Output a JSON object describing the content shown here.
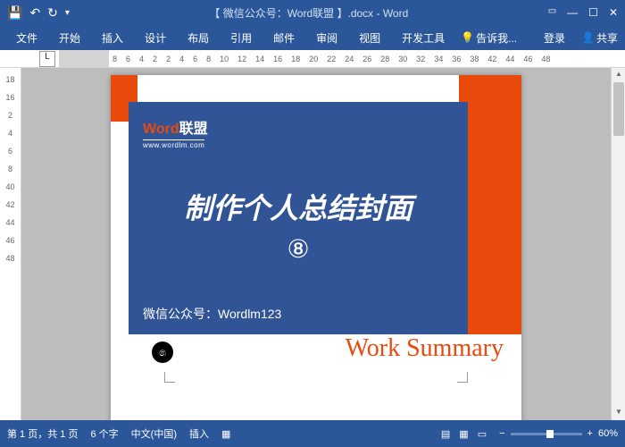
{
  "titlebar": {
    "title": "【 微信公众号：Word联盟 】.docx - Word"
  },
  "tabs": {
    "file": "文件",
    "home": "开始",
    "insert": "插入",
    "design": "设计",
    "layout": "布局",
    "ref": "引用",
    "mail": "邮件",
    "review": "审阅",
    "view": "视图",
    "dev": "开发工具",
    "tell": "告诉我...",
    "login": "登录",
    "share": "共享"
  },
  "ruler_h": [
    "8",
    "6",
    "4",
    "2",
    "2",
    "4",
    "6",
    "8",
    "10",
    "12",
    "14",
    "16",
    "18",
    "20",
    "22",
    "24",
    "26",
    "28",
    "30",
    "32",
    "34",
    "36",
    "38",
    "42",
    "44",
    "46",
    "48"
  ],
  "ruler_v": [
    "18",
    "16",
    "2",
    "4",
    "6",
    "8",
    "40",
    "42",
    "44",
    "46",
    "48"
  ],
  "doc": {
    "logo_word": "Word",
    "logo_cn": "联盟",
    "logo_sub": "www.wordlm.com",
    "big_title": "制作个人总结封面",
    "circled": "⑧",
    "wechat_label": "微信公众号：Wordlm123",
    "work_summary": "Work Summary"
  },
  "status": {
    "page": "第 1 页，共 1 页",
    "words": "6 个字",
    "lang": "中文(中国)",
    "mode": "插入",
    "zoom": "60%"
  }
}
